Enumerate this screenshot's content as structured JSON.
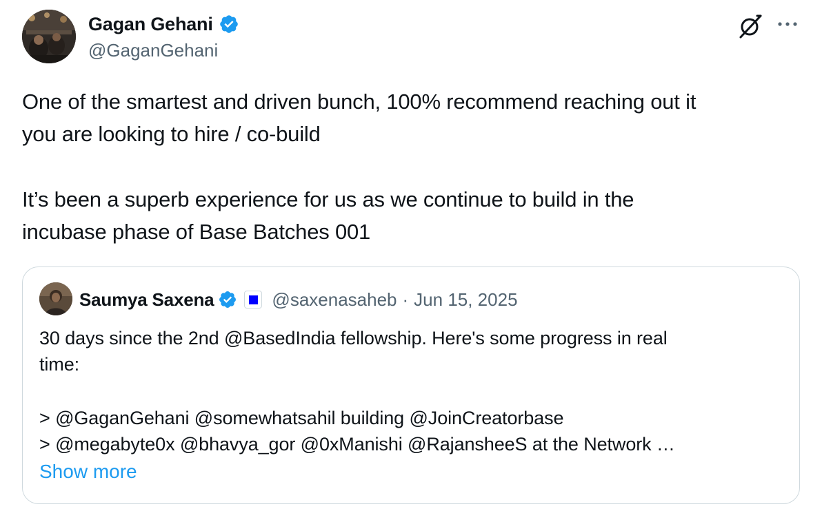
{
  "tweet": {
    "author": {
      "name": "Gagan Gehani",
      "handle": "@GaganGehani",
      "verified": true
    },
    "text_lines": [
      "One of the smartest and driven bunch, 100% recommend reaching out it",
      "you are looking to hire / co-build",
      "It’s been a superb experience for us as we continue to build in the",
      "incubase phase of Base Batches 001"
    ],
    "icons": {
      "grok": "grok-icon",
      "more": "more-icon"
    }
  },
  "quote": {
    "author": {
      "name": "Saumya Saxena",
      "handle": "@saxenasaheb",
      "verified": true,
      "affiliate_badge": "affiliate-badge-icon"
    },
    "separator": "·",
    "date": "Jun 15, 2025",
    "text_lines": [
      "30 days since the 2nd @BasedIndia fellowship. Here's some progress in real",
      "time:",
      "> @GaganGehani @somewhatsahil building @JoinCreatorbase",
      "> @megabyte0x @bhavya_gor @0xManishi @RajansheeS at the Network …"
    ],
    "show_more": "Show more"
  },
  "colors": {
    "text_primary": "#0f1419",
    "text_secondary": "#536471",
    "link": "#1d9bf0",
    "verified": "#1d9bf0",
    "border": "#cfd9de",
    "affiliate": "#0000ff"
  }
}
